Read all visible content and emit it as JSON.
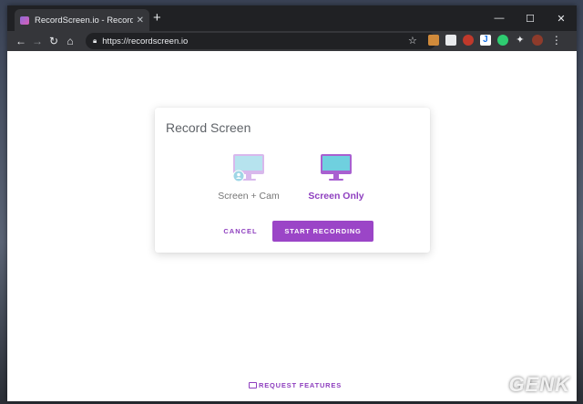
{
  "browser": {
    "tab_title": "RecordScreen.io - Record your sc",
    "tab_close": "✕",
    "new_tab": "+",
    "minimize": "—",
    "maximize": "☐",
    "close": "✕",
    "url": "https://recordscreen.io"
  },
  "dialog": {
    "title": "Record Screen",
    "options": [
      {
        "label": "Screen + Cam",
        "selected": false
      },
      {
        "label": "Screen Only",
        "selected": true
      }
    ],
    "cancel_label": "CANCEL",
    "start_label": "START RECORDING"
  },
  "footer": {
    "request_label": "REQUEST FEATURES"
  },
  "watermark": "GENK",
  "colors": {
    "accent": "#9b45c7",
    "accent_text": "#8e3fbf",
    "monitor_light": "#b6e3ee",
    "monitor_frame_light": "#d8b8ec",
    "monitor_dark": "#6fd0df",
    "monitor_frame_dark": "#a860d0"
  },
  "icons": [
    "back-arrow-icon",
    "forward-arrow-icon",
    "reload-icon",
    "home-icon",
    "lock-icon",
    "star-icon",
    "extensions-icon",
    "menu-icon",
    "monitor-cam-icon",
    "monitor-icon",
    "chat-icon"
  ]
}
